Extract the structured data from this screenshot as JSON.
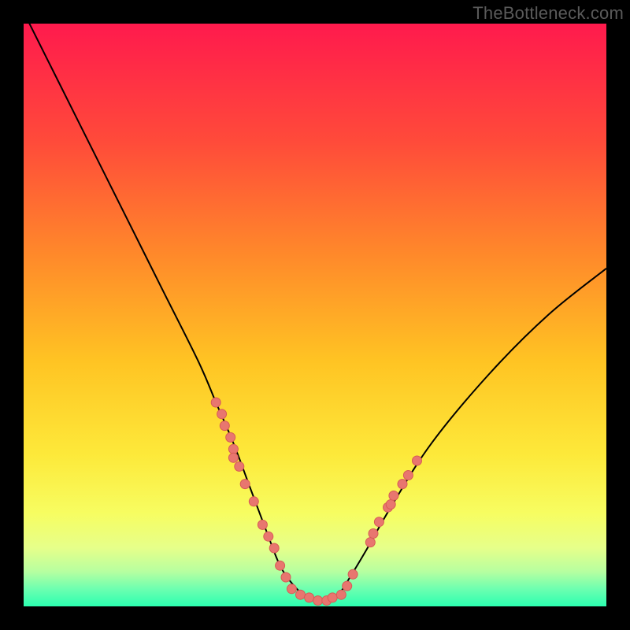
{
  "watermark": "TheBottleneck.com",
  "colors": {
    "black": "#000000",
    "curve": "#000000",
    "marker_fill": "#e8766f",
    "marker_stroke": "#d75b56",
    "gradient_stops": [
      {
        "offset": 0.0,
        "color": "#ff1a4d"
      },
      {
        "offset": 0.2,
        "color": "#ff4a3a"
      },
      {
        "offset": 0.4,
        "color": "#ff8a2a"
      },
      {
        "offset": 0.58,
        "color": "#ffc423"
      },
      {
        "offset": 0.74,
        "color": "#fde93a"
      },
      {
        "offset": 0.84,
        "color": "#f7fd61"
      },
      {
        "offset": 0.9,
        "color": "#e6ff8a"
      },
      {
        "offset": 0.94,
        "color": "#b7ffa0"
      },
      {
        "offset": 0.97,
        "color": "#6dffb0"
      },
      {
        "offset": 1.0,
        "color": "#2bffb0"
      }
    ]
  },
  "chart_data": {
    "type": "line",
    "title": "",
    "xlabel": "",
    "ylabel": "",
    "xlim": [
      0,
      100
    ],
    "ylim": [
      0,
      100
    ],
    "grid": false,
    "series": [
      {
        "name": "bottleneck-curve",
        "x": [
          0,
          6,
          12,
          18,
          24,
          30,
          33,
          36,
          39,
          42,
          44,
          46,
          48,
          50,
          52,
          54,
          56,
          59,
          63,
          70,
          80,
          90,
          100
        ],
        "values": [
          102,
          90,
          78,
          66,
          54,
          42,
          35,
          28,
          20,
          12,
          7,
          4,
          2,
          1,
          1,
          2,
          5,
          10,
          17,
          28,
          40,
          50,
          58
        ]
      }
    ],
    "marker_clusters": [
      {
        "name": "left-slope-cluster",
        "points": [
          {
            "x": 33.0,
            "y": 35.0
          },
          {
            "x": 34.0,
            "y": 33.0
          },
          {
            "x": 34.5,
            "y": 31.0
          },
          {
            "x": 35.5,
            "y": 29.0
          },
          {
            "x": 36.0,
            "y": 27.0
          },
          {
            "x": 36.0,
            "y": 25.5
          },
          {
            "x": 37.0,
            "y": 24.0
          },
          {
            "x": 38.0,
            "y": 21.0
          },
          {
            "x": 39.5,
            "y": 18.0
          },
          {
            "x": 41.0,
            "y": 14.0
          },
          {
            "x": 42.0,
            "y": 12.0
          },
          {
            "x": 43.0,
            "y": 10.0
          },
          {
            "x": 44.0,
            "y": 7.0
          },
          {
            "x": 45.0,
            "y": 5.0
          }
        ]
      },
      {
        "name": "trough-cluster",
        "points": [
          {
            "x": 46.0,
            "y": 3.0
          },
          {
            "x": 47.5,
            "y": 2.0
          },
          {
            "x": 49.0,
            "y": 1.5
          },
          {
            "x": 50.5,
            "y": 1.0
          },
          {
            "x": 52.0,
            "y": 1.0
          },
          {
            "x": 53.0,
            "y": 1.5
          },
          {
            "x": 54.5,
            "y": 2.0
          },
          {
            "x": 55.5,
            "y": 3.5
          },
          {
            "x": 56.5,
            "y": 5.5
          }
        ]
      },
      {
        "name": "right-slope-cluster",
        "points": [
          {
            "x": 59.5,
            "y": 11.0
          },
          {
            "x": 60.0,
            "y": 12.5
          },
          {
            "x": 61.0,
            "y": 14.5
          },
          {
            "x": 62.5,
            "y": 17.0
          },
          {
            "x": 63.0,
            "y": 17.5
          },
          {
            "x": 63.5,
            "y": 19.0
          },
          {
            "x": 65.0,
            "y": 21.0
          },
          {
            "x": 66.0,
            "y": 22.5
          },
          {
            "x": 67.5,
            "y": 25.0
          }
        ]
      }
    ],
    "annotations": []
  }
}
